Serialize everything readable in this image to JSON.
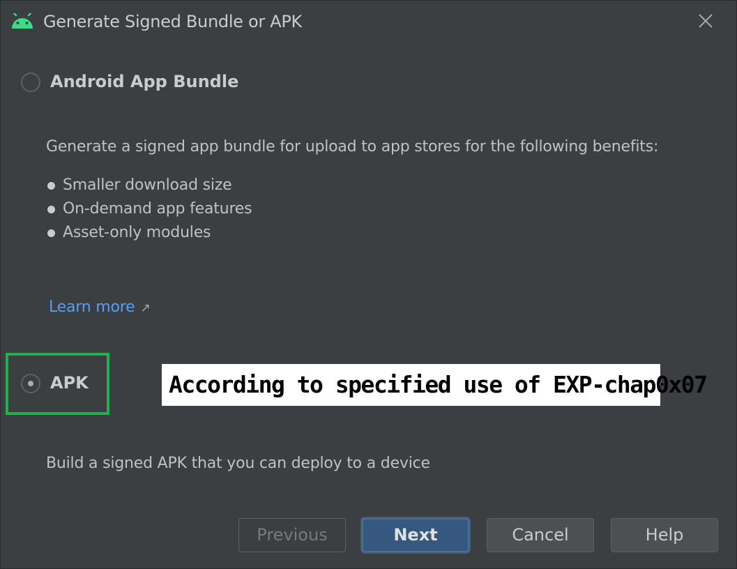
{
  "window": {
    "title": "Generate Signed Bundle or APK",
    "icon": "android-icon",
    "close_icon": "close-icon"
  },
  "options": {
    "bundle": {
      "label": "Android App Bundle",
      "selected": false,
      "description": "Generate a signed app bundle for upload to app stores for the following benefits:",
      "benefits": [
        "Smaller download size",
        "On-demand app features",
        "Asset-only modules"
      ],
      "learn_more": "Learn more",
      "learn_more_icon": "external-link-arrow-icon"
    },
    "apk": {
      "label": "APK",
      "selected": true,
      "description": "Build a signed APK that you can deploy to a device"
    }
  },
  "annotation": {
    "text": "According to specified use of EXP-chap0x07",
    "highlight_color": "#22b24c"
  },
  "buttons": {
    "previous": "Previous",
    "next": "Next",
    "cancel": "Cancel",
    "help": "Help"
  },
  "colors": {
    "background": "#3c3f41",
    "android_green": "#3ddc84",
    "link": "#589df6",
    "primary_button": "#365880"
  }
}
